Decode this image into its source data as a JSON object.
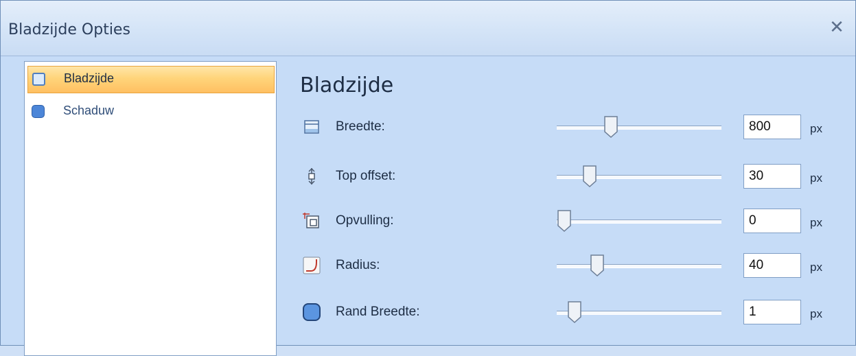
{
  "window": {
    "title": "Bladzijde Opties",
    "close_glyph": "✕"
  },
  "sidebar": {
    "items": [
      {
        "label": "Bladzijde",
        "icon": "page-icon",
        "selected": true
      },
      {
        "label": "Schaduw",
        "icon": "shadow-icon",
        "selected": false
      }
    ]
  },
  "main": {
    "title": "Bladzijde",
    "rows": [
      {
        "label": "Breedte:",
        "icon": "width-icon",
        "value": "800",
        "unit": "px",
        "slider_fraction": 0.31
      },
      {
        "label": "Top offset:",
        "icon": "offset-icon",
        "value": "30",
        "unit": "px",
        "slider_fraction": 0.17
      },
      {
        "label": "Opvulling:",
        "icon": "padding-icon",
        "value": "0",
        "unit": "px",
        "slider_fraction": 0.0
      },
      {
        "label": "Radius:",
        "icon": "radius-icon",
        "value": "40",
        "unit": "px",
        "slider_fraction": 0.22
      },
      {
        "label": "Rand Breedte:",
        "icon": "border-width-icon",
        "value": "1",
        "unit": "px",
        "slider_fraction": 0.07
      }
    ]
  },
  "colors": {
    "selection": "#ffd47a",
    "window_bg": "#c6dcf7",
    "accent": "#4c86d8"
  }
}
